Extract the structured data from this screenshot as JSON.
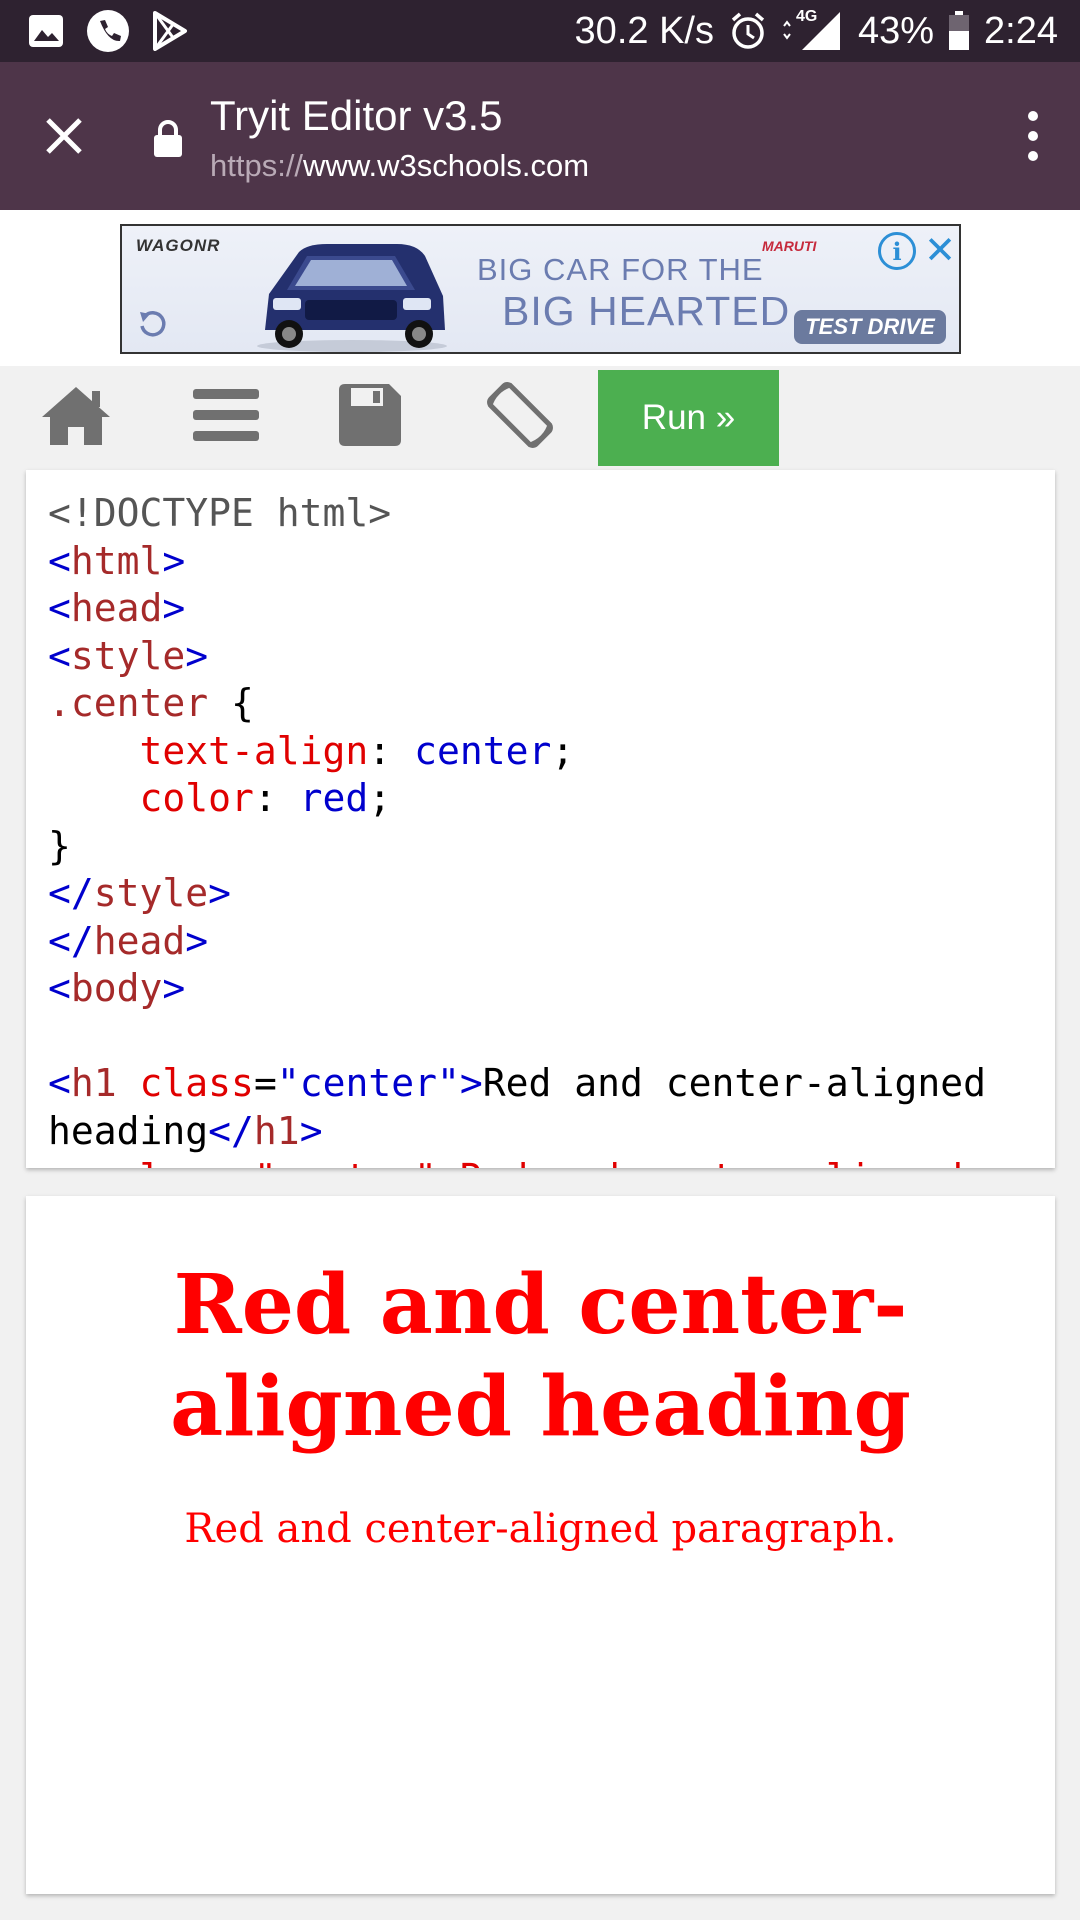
{
  "status_bar": {
    "net_speed": "30.2 K/s",
    "network_type": "4G",
    "battery": "43%",
    "time": "2:24",
    "icons": [
      "image-icon",
      "phone-icon",
      "play-store-icon",
      "alarm-icon",
      "signal-icon",
      "battery-icon"
    ]
  },
  "tab": {
    "title": "Tryit Editor v3.5",
    "url_scheme": "https://",
    "url_host": "www.w3schools.com"
  },
  "ad": {
    "brand": "WAGONR",
    "maker": "MARUTI",
    "line1": "BIG CAR FOR THE",
    "line2": "BIG HEARTED",
    "cta": "TEST DRIVE",
    "info": "i",
    "close": "✕"
  },
  "toolbar": {
    "run_label": "Run »",
    "run_color": "#4caf50"
  },
  "code": {
    "doctype": "<!DOCTYPE html>",
    "html_tag": "html",
    "head_tag": "head",
    "style_tag": "style",
    "selector": ".center",
    "prop1": "text-align",
    "val1": "center",
    "prop2": "color",
    "val2": "red",
    "h1_tag": "h1",
    "h1_attr": "class",
    "h1_attr_val": "\"center\"",
    "h1_text_a": "Red and center-aligned",
    "h1_text_b": "heading",
    "body_tag": "body",
    "partial_line": "<p class=\"center\">Red and center-aligned"
  },
  "result": {
    "heading": "Red and center-aligned heading",
    "paragraph": "Red and center-aligned paragraph.",
    "text_color": "#ff0000"
  }
}
